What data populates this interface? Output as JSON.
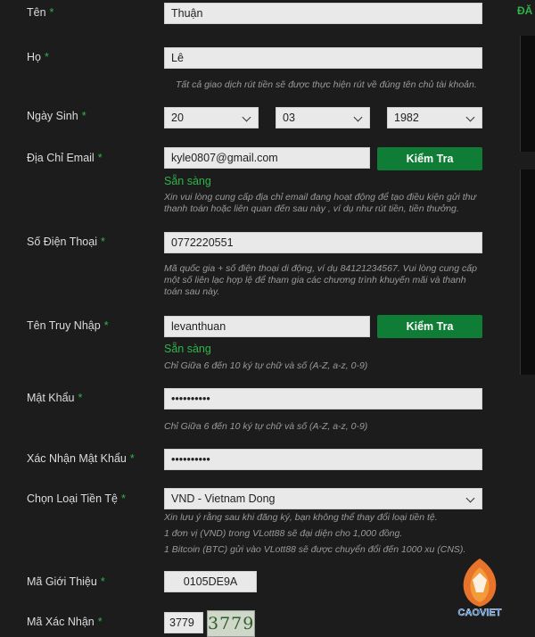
{
  "sidebar": {
    "heading": "ĐĂ"
  },
  "form": {
    "first_name": {
      "label": "Tên",
      "required": "*",
      "value": "Thuận"
    },
    "last_name": {
      "label": "Họ",
      "required": "*",
      "value": "Lê",
      "hint": "Tất cả giao dịch rút tiền sẽ được thực hiện rút về đúng tên chủ tài khoản."
    },
    "birthdate": {
      "label": "Ngày Sinh",
      "required": "*",
      "day": "20",
      "month": "03",
      "year": "1982"
    },
    "email": {
      "label": "Địa Chỉ Email",
      "required": "*",
      "value": "kyle0807@gmail.com",
      "button": "Kiểm Tra",
      "status": "Sẵn sàng",
      "hint": "Xin vui lòng cung cấp địa chỉ email đang hoạt động để tạo điều kiện gửi thư thanh toán hoặc liên quan đến sau này , ví dụ như rút tiền, tiền thưởng."
    },
    "phone": {
      "label": "Số Điện Thoại",
      "required": "*",
      "value": "0772220551",
      "hint": "Mã quốc gia + số điện thoại di động, ví dụ 84121234567. Vui lòng cung cấp một số liên lạc hợp lệ để tham gia các chương trình khuyến mãi và thanh toán sau này."
    },
    "username": {
      "label": "Tên Truy Nhập",
      "required": "*",
      "value": "levanthuan",
      "button": "Kiểm Tra",
      "status": "Sẵn sàng",
      "hint": "Chỉ Giữa 6 đến 10 ký tự chữ và số (A-Z, a-z, 0-9)"
    },
    "password": {
      "label": "Mật Khẩu",
      "required": "*",
      "value": "••••••••••",
      "hint": "Chỉ Giữa 6 đến 10 ký tự chữ và số (A-Z, a-z, 0-9)"
    },
    "confirm_password": {
      "label": "Xác Nhận Mật Khẩu",
      "required": "*",
      "value": "••••••••••"
    },
    "currency": {
      "label": "Chọn Loại Tiền Tệ",
      "required": "*",
      "value": "VND - Vietnam Dong",
      "hint1": "Xin lưu ý rằng sau khi đăng ký, bạn không thể thay đổi loại tiền tệ.",
      "hint2": "1 đơn vị (VND) trong VLott88 sẽ đại diện cho 1,000 đồng.",
      "hint3": "1 Bitcoin (BTC) gửi vào VLott88 sẽ được chuyển đổi đến 1000 xu (CNS)."
    },
    "referral": {
      "label": "Mã Giới Thiệu",
      "required": "*",
      "value": "0105DE9A"
    },
    "captcha": {
      "label": "Mã Xác Nhận",
      "required": "*",
      "value": "3779",
      "image_text": "3779"
    }
  },
  "watermark": {
    "text": "CAOVIET"
  },
  "colors": {
    "accent": "#2fb44a",
    "button": "#0f7d35",
    "background": "#1c1c1c",
    "input": "#e9e9e9"
  }
}
